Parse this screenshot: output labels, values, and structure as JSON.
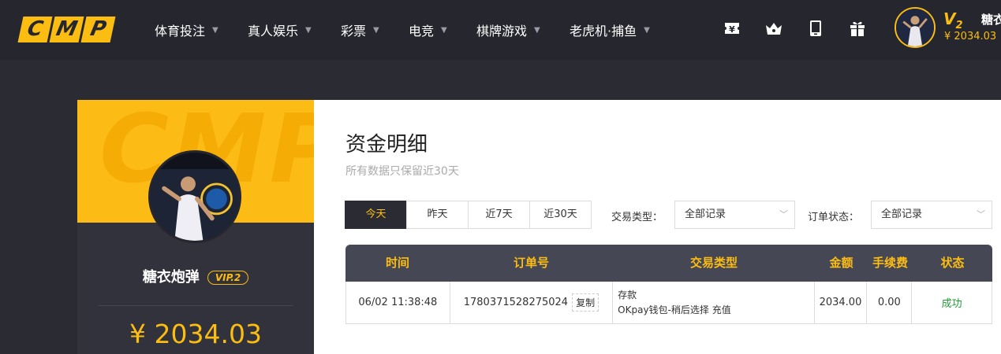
{
  "header": {
    "logo_letters": [
      "C",
      "M",
      "P"
    ],
    "nav": [
      {
        "label": "体育投注"
      },
      {
        "label": "真人娱乐"
      },
      {
        "label": "彩票"
      },
      {
        "label": "电竞"
      },
      {
        "label": "棋牌游戏"
      },
      {
        "label": "老虎机·捕鱼"
      }
    ],
    "tools": [
      "yen-ticket-icon",
      "crown-icon",
      "tablet-icon",
      "gift-icon"
    ],
    "user": {
      "vip": "V",
      "vip_level": "2",
      "name": "糖衣炮弹",
      "balance": "¥ 2034.03"
    }
  },
  "profile": {
    "watermark": "CMP",
    "name": "糖衣炮弹",
    "vip": "VIP.2",
    "balance": "¥ 2034.03"
  },
  "main": {
    "title": "资金明细",
    "subtitle": "所有数据只保留近30天",
    "date_tabs": [
      {
        "label": "今天",
        "active": true
      },
      {
        "label": "昨天",
        "active": false
      },
      {
        "label": "近7天",
        "active": false
      },
      {
        "label": "近30天",
        "active": false
      }
    ],
    "filters": {
      "type_label": "交易类型：",
      "type_value": "全部记录",
      "status_label": "订单状态：",
      "status_value": "全部记录"
    },
    "table": {
      "headers": [
        "时间",
        "订单号",
        "交易类型",
        "金额",
        "手续费",
        "状态"
      ],
      "rows": [
        {
          "time": "06/02 11:38:48",
          "order_no": "1780371528275024",
          "copy": "复制",
          "type_main": "存款",
          "type_detail": "OKpay钱包-稍后选择 充值",
          "amount": "2034.00",
          "fee": "0.00",
          "status": "成功"
        }
      ]
    }
  },
  "colors": {
    "accent": "#fcbd12",
    "header_bg": "#25262e",
    "success": "#1e9a34"
  }
}
